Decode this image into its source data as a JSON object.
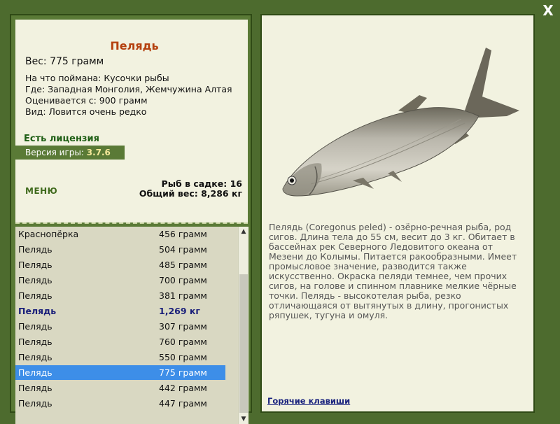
{
  "window": {
    "close_label": "X"
  },
  "fish_info": {
    "name": "Пелядь",
    "weight": "Вес: 775 грамм",
    "caught_on": "На что поймана: Кусочки рыбы",
    "where": "Где: Западная Монголия, Жемчужина Алтая",
    "price": "Оценивается с: 900 грамм",
    "rarity": "Вид: Ловится очень редко"
  },
  "license": "Есть лицензия",
  "version": {
    "label": "Версия игры:",
    "value": "3.7.6"
  },
  "menu_label": "МЕНЮ",
  "cage": {
    "count": "Рыб в садке: 16",
    "total_weight": "Общий вес: 8,286 кг"
  },
  "catch_list": [
    {
      "name": "Краснопёрка",
      "weight": "456 грамм"
    },
    {
      "name": "Пелядь",
      "weight": "504 грамм"
    },
    {
      "name": "Пелядь",
      "weight": "485 грамм"
    },
    {
      "name": "Пелядь",
      "weight": "700 грамм"
    },
    {
      "name": "Пелядь",
      "weight": "381 грамм"
    },
    {
      "name": "Пелядь",
      "weight": "1,269 кг"
    },
    {
      "name": "Пелядь",
      "weight": "307 грамм"
    },
    {
      "name": "Пелядь",
      "weight": "760 грамм"
    },
    {
      "name": "Пелядь",
      "weight": "550 грамм"
    },
    {
      "name": "Пелядь",
      "weight": "775 грамм"
    },
    {
      "name": "Пелядь",
      "weight": "442 грамм"
    },
    {
      "name": "Пелядь",
      "weight": "447 грамм"
    }
  ],
  "description": "Пелядь (Coregonus peled) - озёрно-речная рыба, род сигов. Длина тела до 55 см, весит до 3 кг. Обитает в бассейнах рек Северного Ледовитого океана от Мезени до Колымы. Питается ракообразными. Имеет промысловое значение, разводится также искусственно. Окраска пеляди темнее, чем прочих сигов, на голове и спинном плавнике мелкие чёрные точки. Пелядь - высокотелая рыба, резко отличающаяся от вытянутых в длину, прогонистых ряпушек, тугуна и омуля.",
  "hotkeys_label": "Горячие клавиши",
  "colors": {
    "background": "#4d6b2e",
    "panel": "#f2f2e0",
    "name": "#b5410f",
    "selection": "#3d8ee8"
  }
}
